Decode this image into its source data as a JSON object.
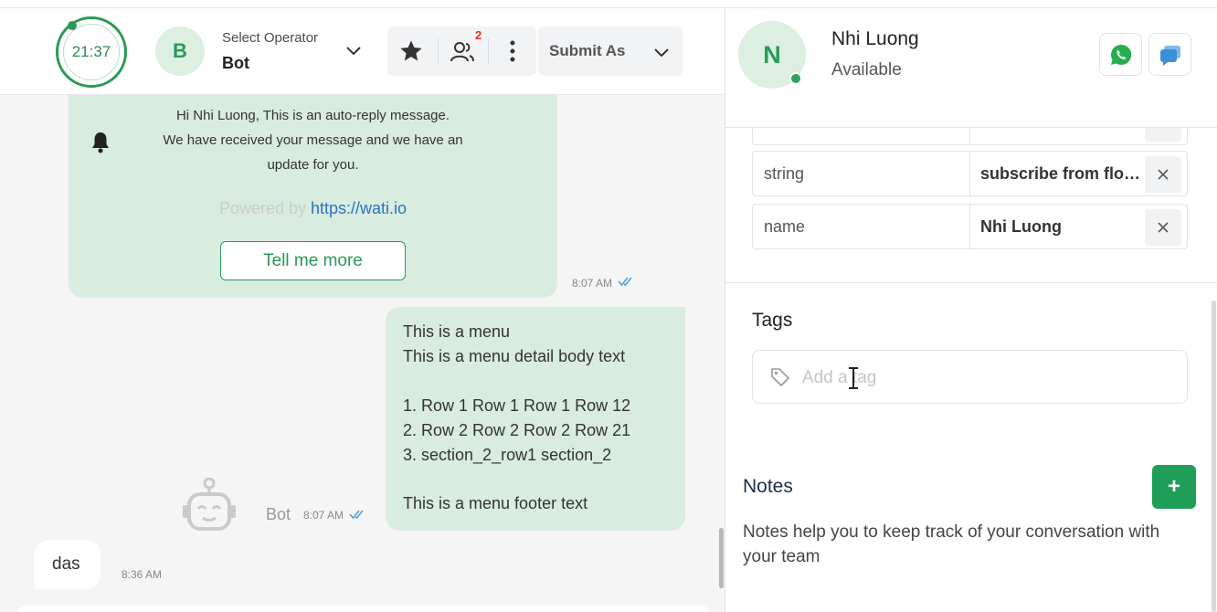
{
  "header": {
    "timer": "21:37",
    "operator_initial": "B",
    "operator_label": "Select Operator",
    "operator_value": "Bot",
    "participants_badge": "2",
    "submit_label": "Submit As"
  },
  "messages": {
    "auto_reply": {
      "line1": "Hi Nhi Luong, This is an auto-reply message.",
      "line2": "We have received your message and we have an",
      "line3": "update for you.",
      "powered_prefix": "Powered by",
      "powered_link": "https://wati.io",
      "button_label": "Tell me more",
      "time": "8:07 AM"
    },
    "menu": {
      "lines": [
        "This is a menu",
        "This is a menu detail body text",
        "1. Row 1 Row 1 Row 1 Row 12",
        "2. Row 2 Row 2 Row 2 Row 21",
        "3. section_2_row1 section_2",
        "This is a menu footer text"
      ],
      "sender": "Bot",
      "time": "8:07 AM"
    },
    "customer": {
      "text": "das",
      "time": "8:36 AM"
    }
  },
  "contact": {
    "initial": "N",
    "name": "Nhi Luong",
    "status": "Available"
  },
  "attributes": [
    {
      "key": "string",
      "value": "subscribe from flow..."
    },
    {
      "key": "name",
      "value": "Nhi Luong"
    }
  ],
  "tags": {
    "title": "Tags",
    "placeholder": "Add a tag"
  },
  "notes": {
    "title": "Notes",
    "add_label": "+",
    "help": "Notes help you to keep track of your conversation with your team"
  },
  "colors": {
    "brand_green": "#2a9a57",
    "bubble_green": "#d9ece0",
    "badge_red": "#e0322f",
    "link_blue": "#2a72c4"
  }
}
